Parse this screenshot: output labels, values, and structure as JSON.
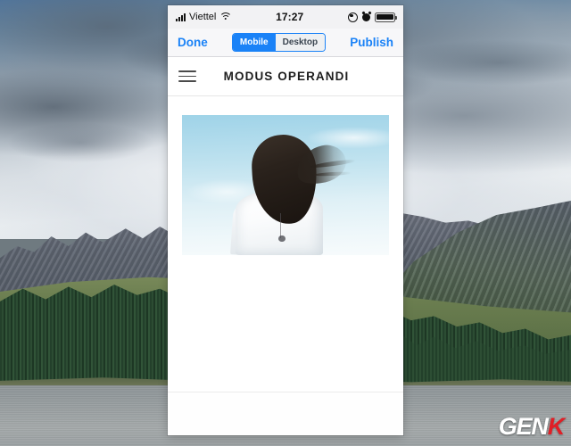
{
  "background": {
    "description": "mountain-lake-landscape-photo",
    "sky_color": "#b9c3cc",
    "forest_color": "#2d5135",
    "lake_color": "#989ea0"
  },
  "watermark": {
    "part1": "GEN",
    "part2": "K",
    "part1_color": "#ffffff",
    "part2_color": "#e01f26"
  },
  "phone": {
    "status_bar": {
      "carrier": "Viettel",
      "time": "17:27",
      "signal_icon": "signal-bars-icon",
      "wifi_icon": "wifi-icon",
      "location_icon": "location-services-icon",
      "alarm_icon": "alarm-clock-icon",
      "battery_icon": "battery-full-icon"
    },
    "toolbar": {
      "done_label": "Done",
      "publish_label": "Publish",
      "accent_color": "#1a82f7",
      "segments": [
        {
          "label": "Mobile",
          "active": true
        },
        {
          "label": "Desktop",
          "active": false
        }
      ]
    },
    "site_header": {
      "menu_icon": "hamburger-menu-icon",
      "title": "MODUS OPERANDI"
    },
    "content": {
      "hero_image_alt": "woman-with-long-dark-hair-against-blue-sky"
    }
  }
}
